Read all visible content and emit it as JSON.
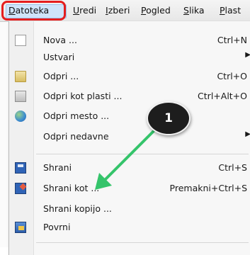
{
  "menubar": {
    "items": [
      {
        "label": "Datoteka",
        "mnemonic_index": 0
      },
      {
        "label": "Uredi",
        "mnemonic_index": 0
      },
      {
        "label": "Izberi",
        "mnemonic_index": 0
      },
      {
        "label": "Pogled",
        "mnemonic_index": 0
      },
      {
        "label": "Slika",
        "mnemonic_index": 0
      },
      {
        "label": "Plast",
        "mnemonic_index": 0
      }
    ]
  },
  "menu": {
    "items": [
      {
        "label": "Nova ...",
        "shortcut": "Ctrl+N",
        "icon": "new-document-icon",
        "submenu": false
      },
      {
        "label": "Ustvari",
        "shortcut": "",
        "icon": "",
        "submenu": true
      },
      {
        "label": "Odpri ...",
        "shortcut": "Ctrl+O",
        "icon": "folder-icon",
        "submenu": false
      },
      {
        "label": "Odpri kot plasti ...",
        "shortcut": "Ctrl+Alt+O",
        "icon": "open-as-layers-icon",
        "submenu": false
      },
      {
        "label": "Odpri mesto ...",
        "shortcut": "",
        "icon": "globe-icon",
        "submenu": false
      },
      {
        "label": "Odpri nedavne",
        "shortcut": "",
        "icon": "",
        "submenu": true
      },
      {
        "label": "Shrani",
        "shortcut": "Ctrl+S",
        "icon": "save-icon",
        "submenu": false
      },
      {
        "label": "Shrani kot ...",
        "shortcut": "Premakni+Ctrl+S",
        "icon": "save-as-icon",
        "submenu": false
      },
      {
        "label": "Shrani kopijo ...",
        "shortcut": "",
        "icon": "",
        "submenu": false
      },
      {
        "label": "Povrni",
        "shortcut": "",
        "icon": "revert-icon",
        "submenu": false
      }
    ]
  },
  "callout": {
    "number": "1",
    "badge_color": "#1d1d1d",
    "arrow_color": "#35c46b",
    "ring_color": "#e51e1e"
  }
}
